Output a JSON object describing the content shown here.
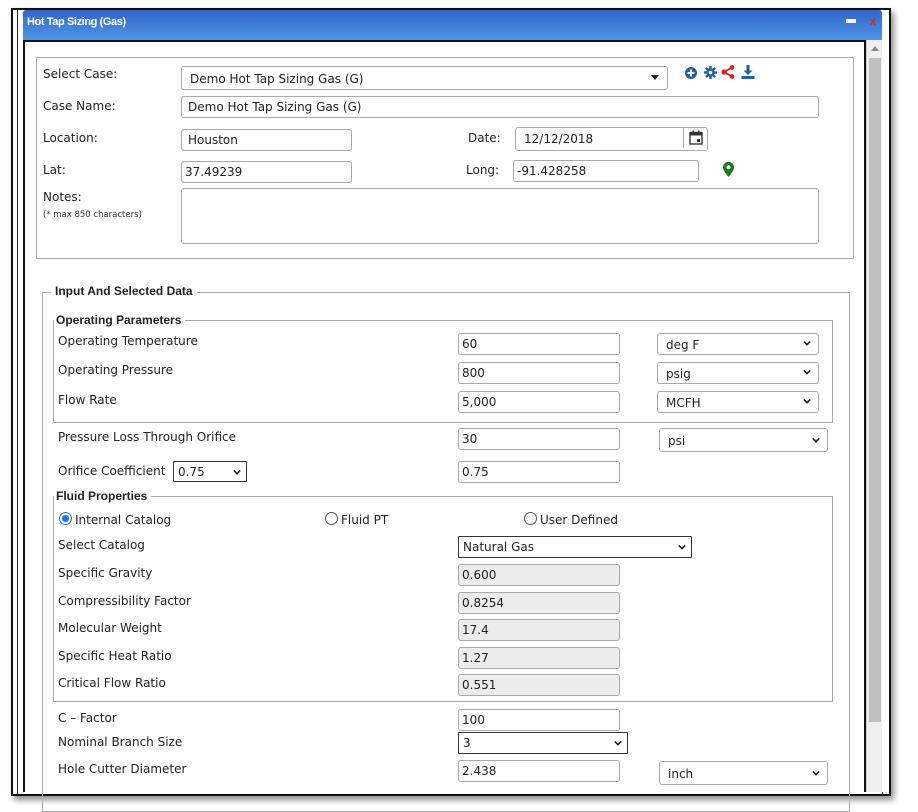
{
  "window": {
    "title": "Hot Tap Sizing (Gas)",
    "minimize_icon": "minimize-icon",
    "close_icon": "close-icon",
    "close_glyph": "x"
  },
  "case": {
    "select_case_label": "Select Case:",
    "select_case_value": "Demo Hot Tap Sizing Gas (G)",
    "toolbar_icons": [
      "add-circle-icon",
      "gear-icon",
      "share-icon",
      "download-icon"
    ],
    "case_name_label": "Case Name:",
    "case_name_value": "Demo Hot Tap Sizing Gas (G)",
    "location_label": "Location:",
    "location_value": "Houston",
    "date_label": "Date:",
    "date_value": "12/12/2018",
    "lat_label": "Lat:",
    "lat_value": "37.49239",
    "long_label": "Long:",
    "long_value": "-91.428258",
    "notes_label": "Notes:",
    "notes_hint": "(* max 850 characters)",
    "notes_value": ""
  },
  "input_section": {
    "legend": "Input And Selected Data",
    "operating": {
      "legend": "Operating Parameters",
      "rows": [
        {
          "label": "Operating Temperature",
          "value": "60",
          "unit": "deg F"
        },
        {
          "label": "Operating Pressure",
          "value": "800",
          "unit": "psig"
        },
        {
          "label": "Flow Rate",
          "value": "5,000",
          "unit": "MCFH"
        }
      ]
    },
    "pressure_loss": {
      "label": "Pressure Loss Through Orifice",
      "value": "30",
      "unit": "psi"
    },
    "orifice": {
      "label": "Orifice Coefficient",
      "select_value": "0.75",
      "value": "0.75"
    },
    "fluid": {
      "legend": "Fluid Properties",
      "radios": [
        {
          "label": "Internal Catalog",
          "checked": true
        },
        {
          "label": "Fluid PT",
          "checked": false
        },
        {
          "label": "User Defined",
          "checked": false
        }
      ],
      "catalog_label": "Select Catalog",
      "catalog_value": "Natural Gas",
      "properties": [
        {
          "label": "Specific Gravity",
          "value": "0.600"
        },
        {
          "label": "Compressibility Factor",
          "value": "0.8254"
        },
        {
          "label": "Molecular Weight",
          "value": "17.4"
        },
        {
          "label": "Specific Heat Ratio",
          "value": "1.27"
        },
        {
          "label": "Critical Flow Ratio",
          "value": "0.551"
        }
      ]
    },
    "c_factor": {
      "label": "C – Factor",
      "value": "100"
    },
    "branch_size": {
      "label": "Nominal Branch Size",
      "value": "3"
    },
    "hole_cutter": {
      "label": "Hole Cutter Diameter",
      "value": "2.438",
      "unit": "inch"
    }
  },
  "colors": {
    "title_bar": "#3a7ad6",
    "icon_blue": "#1f5fa8",
    "share_red": "#e02020",
    "pin_green": "#1a7a1a",
    "radio_blue": "#1a73e8"
  }
}
